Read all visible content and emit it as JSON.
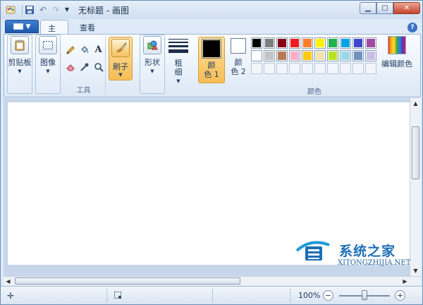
{
  "window": {
    "title": "无标题 - 画图",
    "min_icon": "minimize-icon",
    "max_icon": "maximize-icon",
    "close_icon": "close-icon"
  },
  "quick_access": {
    "app_icon": "paint-app-icon",
    "save_icon": "save-icon",
    "undo_icon": "undo-icon",
    "redo_icon": "redo-icon",
    "customize_icon": "chevron-down-icon"
  },
  "tabs": {
    "home": "主页",
    "view": "查看"
  },
  "ribbon": {
    "clipboard": {
      "label": "剪贴板"
    },
    "image": {
      "label": "图像"
    },
    "tools": {
      "group_label": "工具"
    },
    "brushes": {
      "label": "刷子"
    },
    "shapes": {
      "label": "形状"
    },
    "size": {
      "label_line1": "粗",
      "label_line2": "细"
    },
    "color1": {
      "label_line1": "颜",
      "label_line2": "色 1",
      "value": "#000000"
    },
    "color2": {
      "label_line1": "颜",
      "label_line2": "色 2",
      "value": "#ffffff"
    },
    "colors_group_label": "颜色",
    "edit_colors": "编辑颜色",
    "palette": [
      "#000000",
      "#7f7f7f",
      "#880015",
      "#ed1c24",
      "#ff7f27",
      "#fff200",
      "#22b14c",
      "#00a2e8",
      "#3f48cc",
      "#a349a4",
      "#ffffff",
      "#c3c3c3",
      "#b97a57",
      "#ffaec9",
      "#ffc90e",
      "#efe4b0",
      "#b5e61d",
      "#99d9ea",
      "#7092be",
      "#c8bfe7",
      "",
      "",
      "",
      "",
      "",
      "",
      "",
      "",
      "",
      ""
    ]
  },
  "watermark": {
    "title": "系统之家",
    "url": "XITONGZHIJIA.NET"
  },
  "status": {
    "zoom": "100%",
    "zoom_level": 0.5
  }
}
